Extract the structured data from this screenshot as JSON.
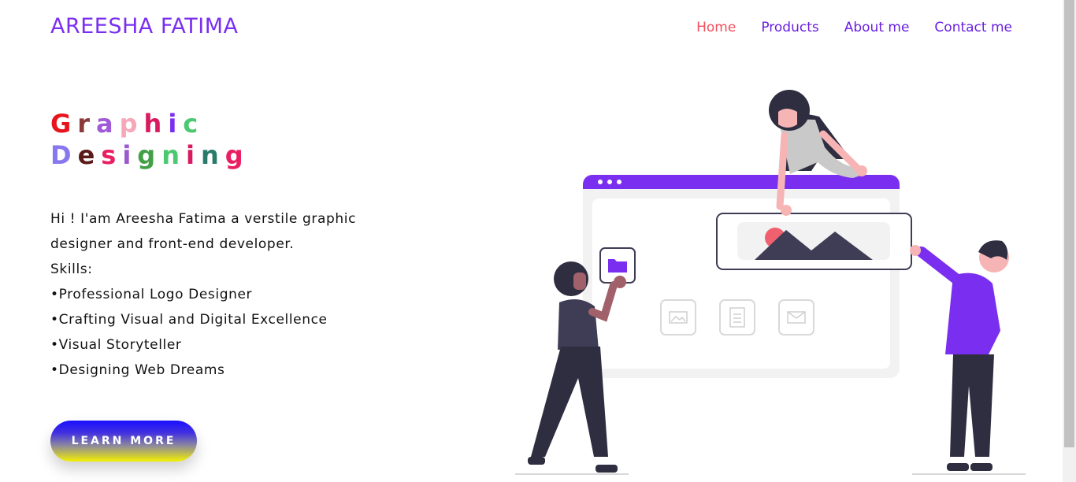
{
  "header": {
    "logo": "AREESHA FATIMA",
    "nav": [
      {
        "label": "Home",
        "active": true
      },
      {
        "label": "Products"
      },
      {
        "label": "About me"
      },
      {
        "label": "Contact me"
      }
    ]
  },
  "hero": {
    "title_line1": [
      "G",
      "r",
      "a",
      "p",
      "h",
      "i",
      "c"
    ],
    "title_line2": [
      "D",
      "e",
      "s",
      "i",
      "g",
      "n",
      "i",
      "n",
      "g"
    ],
    "title_colors_line1": [
      "#e8141c",
      "#8b3a3a",
      "#a05ad8",
      "#f7a8b8",
      "#d81b60",
      "#7a2ff0",
      "#4cc970"
    ],
    "title_colors_line2": [
      "#8878f0",
      "#5a1a1a",
      "#e91e63",
      "#9b59d0",
      "#43a047",
      "#4cc970",
      "#d81b60",
      "#2a7a6a",
      "#e91e63"
    ],
    "intro_line": "Hi ! I'am Areesha Fatima a verstile graphic designer and front-end developer.",
    "skills_heading": "Skills:",
    "skills": [
      "•Professional Logo Designer",
      "•Crafting Visual and Digital Excellence",
      "•Visual Storyteller",
      "•Designing Web Dreams"
    ],
    "button_label": "LEARN MORE"
  },
  "colors": {
    "brand": "#7a2ff0",
    "nav_active": "#f0505e",
    "illustration_accent": "#7a2ff0",
    "illustration_pink": "#f0606e"
  },
  "illustration": {
    "icons": [
      "folder-icon",
      "image-icon",
      "document-icon",
      "mail-icon"
    ]
  }
}
